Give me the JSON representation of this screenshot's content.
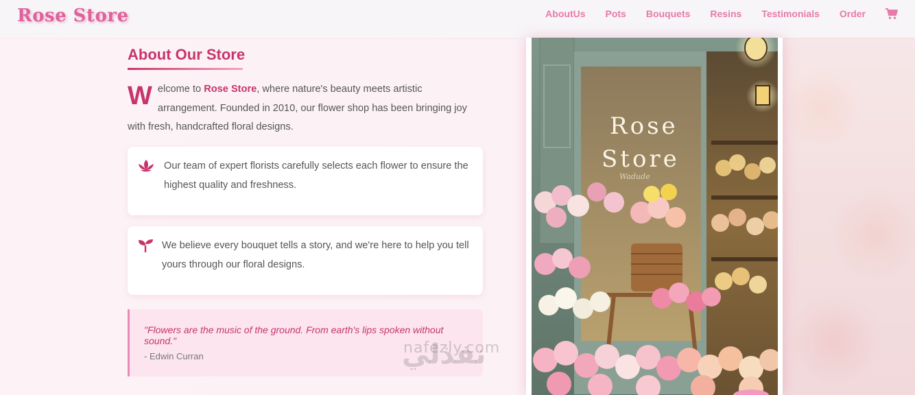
{
  "header": {
    "logo": "Rose Store",
    "nav": [
      "AboutUs",
      "Pots",
      "Bouquets",
      "Resins",
      "Testimonials",
      "Order"
    ],
    "cart_icon": "shopping-cart-icon"
  },
  "about": {
    "title": "About Our Store",
    "dropcap": "W",
    "intro_before": "elcome to ",
    "brand": "Rose Store",
    "intro_after": ", where nature's beauty meets artistic arrangement. Founded in 2010, our flower shop has been bringing joy with fresh, handcrafted floral designs.",
    "cards": [
      {
        "icon": "lotus-icon",
        "text": "Our team of expert florists carefully selects each flower to ensure the highest quality and freshness."
      },
      {
        "icon": "seedling-icon",
        "text": "We believe every bouquet tells a story, and we're here to help you tell yours through our floral designs."
      }
    ],
    "quote": {
      "text": "\"Flowers are the music of the ground. From earth's lips spoken without sound.\"",
      "author": "- Edwin Curran"
    }
  },
  "storefront": {
    "sign_line1": "Rose",
    "sign_line2": "Store",
    "sign_small": "Wadude"
  },
  "watermark": {
    "arabic": "نفذلي",
    "latin": "nafezly.com"
  },
  "colors": {
    "accent": "#c7346b",
    "nav": "#e87aa8",
    "logo": "#e0619a",
    "quote_bg": "#fce5ef"
  }
}
